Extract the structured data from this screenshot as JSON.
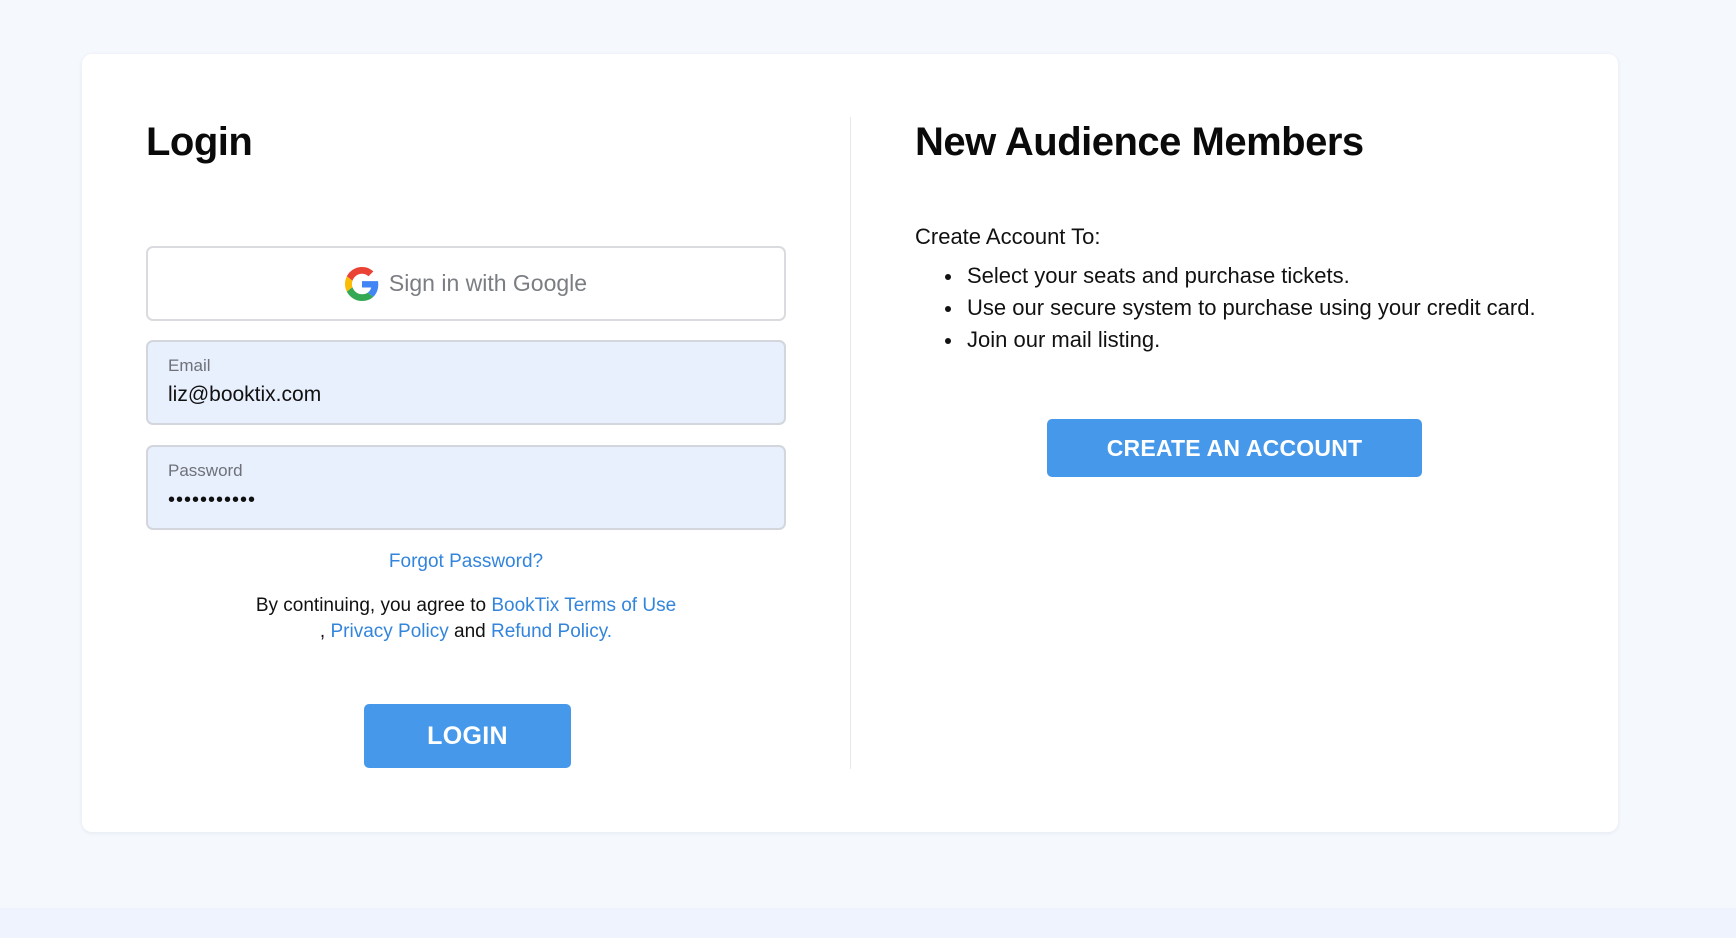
{
  "login": {
    "title": "Login",
    "google_button_label": "Sign in with Google",
    "email": {
      "label": "Email",
      "value": "liz@booktix.com"
    },
    "password": {
      "label": "Password",
      "value": "•••••••••••"
    },
    "forgot_password": "Forgot Password?",
    "terms": {
      "prefix": "By continuing, you agree to ",
      "terms_link": "BookTix Terms of Use",
      "separator": ", ",
      "privacy_link": "Privacy Policy",
      "conjunction": " and ",
      "refund_link": "Refund Policy."
    },
    "login_button": "LOGIN"
  },
  "signup": {
    "title": "New Audience Members",
    "intro": "Create Account To:",
    "benefits": [
      "Select your seats and purchase tickets.",
      "Use our secure system to purchase using your credit card.",
      "Join our mail listing."
    ],
    "create_button": "CREATE AN ACCOUNT"
  },
  "colors": {
    "accent": "#4699ea",
    "link": "#3385dc",
    "field_background": "#e8effd",
    "page_background": "#f5f8fd"
  },
  "icons": {
    "google": "google-g-icon"
  }
}
